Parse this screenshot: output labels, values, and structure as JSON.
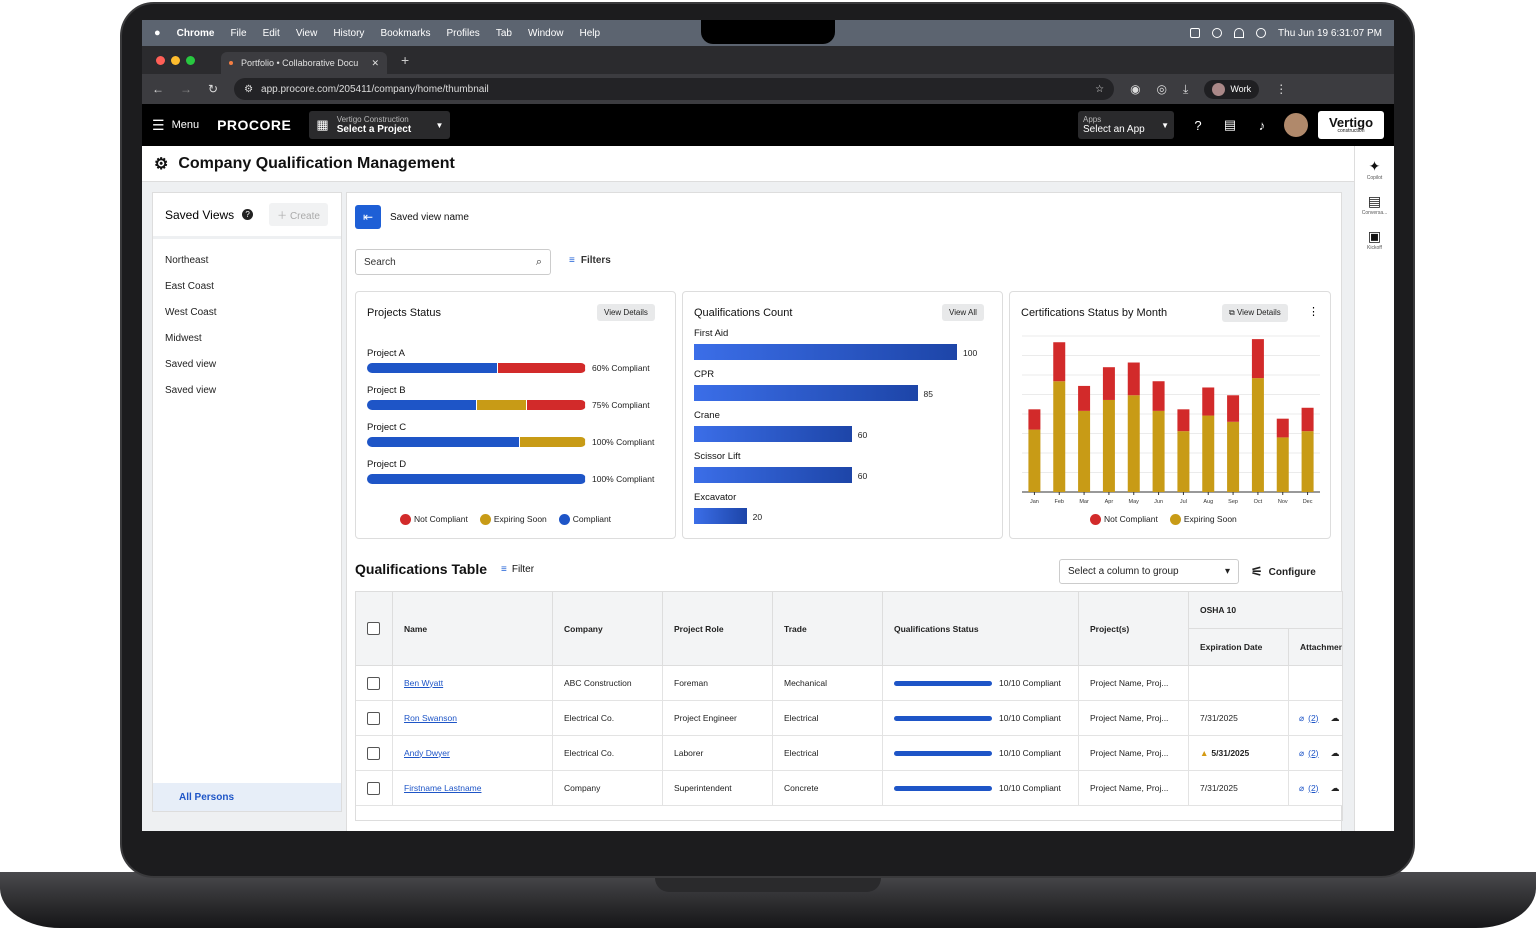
{
  "menubar": {
    "apple": "",
    "app": "Chrome",
    "items": [
      "File",
      "Edit",
      "View",
      "History",
      "Bookmarks",
      "Profiles",
      "Tab",
      "Window",
      "Help"
    ],
    "clock": "Thu Jun 19  6:31:07 PM"
  },
  "browser": {
    "tab_title": "Portfolio • Collaborative Docu",
    "url": "app.procore.com/205411/company/home/thumbnail",
    "profile": "Work"
  },
  "header": {
    "menu": "Menu",
    "logo": "PROCORE",
    "company": "Vertigo Construction",
    "project": "Select a Project",
    "apps_label": "Apps",
    "apps_value": "Select an App",
    "brand": "Vertigo",
    "brand_sub": "construction"
  },
  "page": {
    "title": "Company Qualification Management"
  },
  "rail": [
    {
      "icon": "copilot-icon",
      "label": "Copilot"
    },
    {
      "icon": "conversations-icon",
      "label": "Conversa..."
    },
    {
      "icon": "kickoff-icon",
      "label": "Kickoff"
    }
  ],
  "saved_views": {
    "title": "Saved Views",
    "create": "Create",
    "items": [
      "Northeast",
      "East Coast",
      "West Coast",
      "Midwest",
      "Saved view",
      "Saved view"
    ],
    "footer": "All Persons"
  },
  "main": {
    "saved_view_name": "Saved view name",
    "search_placeholder": "Search",
    "filters": "Filters"
  },
  "projects_status": {
    "title": "Projects Status",
    "button": "View Details",
    "projects": [
      {
        "name": "Project A",
        "compliant": 60,
        "expiring": 0,
        "not_compliant": 40,
        "label": "60% Compliant"
      },
      {
        "name": "Project B",
        "compliant": 50,
        "expiring": 23,
        "not_compliant": 27,
        "label": "75% Compliant"
      },
      {
        "name": "Project C",
        "compliant": 70,
        "expiring": 30,
        "not_compliant": 0,
        "label": "100% Compliant"
      },
      {
        "name": "Project D",
        "compliant": 100,
        "expiring": 0,
        "not_compliant": 0,
        "label": "100% Compliant"
      }
    ],
    "legend": [
      "Not Compliant",
      "Expiring Soon",
      "Compliant"
    ]
  },
  "qual_count": {
    "title": "Qualifications Count",
    "button": "View All",
    "max": 100,
    "items": [
      {
        "name": "First Aid",
        "value": 100
      },
      {
        "name": "CPR",
        "value": 85
      },
      {
        "name": "Crane",
        "value": 60
      },
      {
        "name": "Scissor Lift",
        "value": 60
      },
      {
        "name": "Excavator",
        "value": 20
      }
    ]
  },
  "chart_data": {
    "type": "bar",
    "stacked": true,
    "title": "Certifications Status by Month",
    "button": "View Details",
    "categories": [
      "Jan",
      "Feb",
      "Mar",
      "Apr",
      "May",
      "Jun",
      "Jul",
      "Aug",
      "Sep",
      "Oct",
      "Nov",
      "Dec"
    ],
    "ylim": [
      0,
      100
    ],
    "series": [
      {
        "name": "Expiring Soon",
        "values": [
          40,
          71,
          52,
          59,
          62,
          52,
          39,
          49,
          45,
          73,
          35,
          39
        ]
      },
      {
        "name": "Not Compliant",
        "values": [
          13,
          25,
          16,
          21,
          21,
          19,
          14,
          18,
          17,
          25,
          12,
          15
        ]
      }
    ],
    "legend_position": "bottom",
    "grid": true
  },
  "colors": {
    "compliant": "#1e55c7",
    "expiring": "#c89b16",
    "not_compliant": "#d22a2a",
    "accent": "#1e5fd6"
  },
  "table": {
    "title": "Qualifications Table",
    "filter": "Filter",
    "group_placeholder": "Select a column to group",
    "configure": "Configure",
    "columns": [
      "Name",
      "Company",
      "Project Role",
      "Trade",
      "Qualifications Status",
      "Project(s)"
    ],
    "group_header": "OSHA 10",
    "sub_columns": [
      "Expiration Date",
      "Attachments"
    ],
    "rows": [
      {
        "name": "Ben Wyatt",
        "company": "ABC Construction",
        "role": "Foreman",
        "trade": "Mechanical",
        "status": "10/10 Compliant",
        "projects": "Project Name, Proj...",
        "exp": "",
        "warn": false,
        "attach": ""
      },
      {
        "name": "Ron Swanson",
        "company": "Electrical Co.",
        "role": "Project Engineer",
        "trade": "Electrical",
        "status": "10/10 Compliant",
        "projects": "Project Name, Proj...",
        "exp": "7/31/2025",
        "warn": false,
        "attach": "(2)"
      },
      {
        "name": "Andy Dwyer",
        "company": "Electrical Co.",
        "role": "Laborer",
        "trade": "Electrical",
        "status": "10/10 Compliant",
        "projects": "Project Name, Proj...",
        "exp": "5/31/2025",
        "warn": true,
        "attach": "(2)"
      },
      {
        "name": "Firstname Lastname",
        "company": "Company",
        "role": "Superintendent",
        "trade": "Concrete",
        "status": "10/10 Compliant",
        "projects": "Project Name, Proj...",
        "exp": "7/31/2025",
        "warn": false,
        "attach": "(2)"
      }
    ]
  }
}
